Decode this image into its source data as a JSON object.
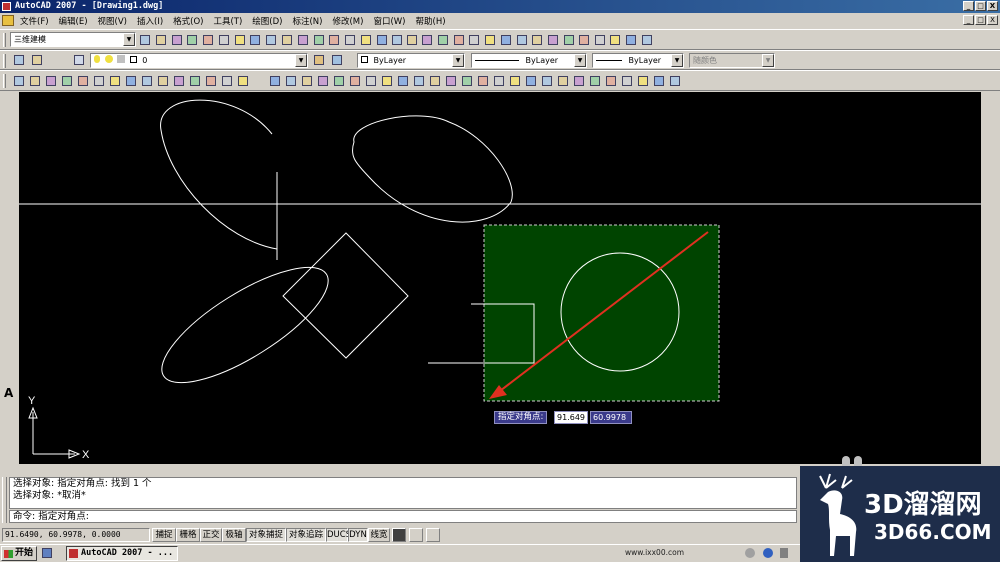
{
  "window": {
    "title": "AutoCAD 2007 - [Drawing1.dwg]",
    "buttons": [
      "_",
      "□",
      "X"
    ]
  },
  "menu": [
    "文件(F)",
    "编辑(E)",
    "视图(V)",
    "插入(I)",
    "格式(O)",
    "工具(T)",
    "绘图(D)",
    "标注(N)",
    "修改(M)",
    "窗口(W)",
    "帮助(H)"
  ],
  "toolbar": {
    "workspace": "三维建模",
    "layer": "0",
    "color": "ByLayer",
    "linetype": "ByLayer",
    "lineweight": "ByLayer",
    "plotstyle": "随颜色"
  },
  "canvas": {
    "ucs_x": "X",
    "ucs_y": "Y",
    "dynamic_prompt": "指定对角点:",
    "dyn_x": "91.649",
    "dyn_y": "60.9978"
  },
  "command": {
    "history": [
      "选择对象: 指定对角点: 找到 1 个",
      "选择对象: *取消*"
    ],
    "prompt": "命令: 指定对角点:"
  },
  "status": {
    "coords": "91.6490, 60.9978, 0.0000",
    "modes": [
      "捕捉",
      "栅格",
      "正交",
      "极轴",
      "对象捕捉",
      "对象追踪",
      "DUCS",
      "DYN",
      "线宽"
    ]
  },
  "taskbar": {
    "start": "开始",
    "item": "AutoCAD 2007 - ...",
    "url": "www.ixx00.com"
  },
  "watermark": {
    "line1": "3D溜溜网",
    "line2": "3D66.COM"
  },
  "colors": {
    "selection_fill": "#004400",
    "arrow": "#e03020",
    "canvas": "#000000"
  }
}
